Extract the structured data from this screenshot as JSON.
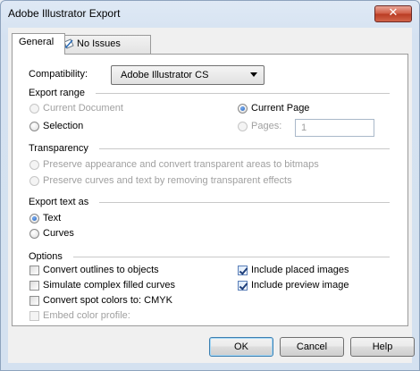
{
  "window": {
    "title": "Adobe Illustrator Export",
    "close_glyph": "✕"
  },
  "tabs": [
    {
      "label": "General"
    },
    {
      "label": "No Issues",
      "icon": "check-document-icon"
    }
  ],
  "compatibility": {
    "label": "Compatibility:",
    "value": "Adobe Illustrator CS"
  },
  "export_range": {
    "title": "Export range",
    "current_document": "Current Document",
    "selection": "Selection",
    "current_page": "Current Page",
    "pages": "Pages:",
    "pages_value": "1"
  },
  "transparency": {
    "title": "Transparency",
    "preserve_appearance": "Preserve appearance and convert transparent areas to bitmaps",
    "preserve_curves": "Preserve curves and text by removing transparent effects"
  },
  "export_text": {
    "title": "Export text as",
    "text": "Text",
    "curves": "Curves"
  },
  "options": {
    "title": "Options",
    "convert_outlines": "Convert outlines to objects",
    "simulate_fills": "Simulate complex filled curves",
    "convert_spot": "Convert spot colors to:",
    "spot_target": "CMYK",
    "embed_profile": "Embed color profile:",
    "include_placed": "Include placed images",
    "include_preview": "Include preview image"
  },
  "buttons": {
    "ok": "OK",
    "cancel": "Cancel",
    "help": "Help"
  }
}
